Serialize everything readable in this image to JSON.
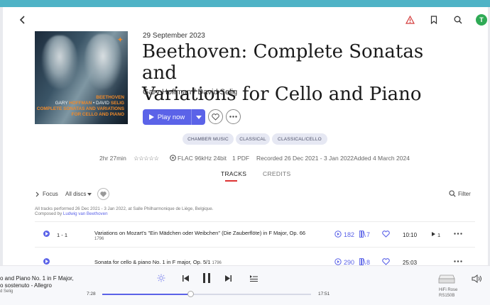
{
  "album": {
    "date": "29 September 2023",
    "title_line1": "Beethoven: Complete Sonatas and",
    "title_line2": "Variations for Cello and Piano",
    "artists": "Gary Hoffman / David Selig",
    "cover": {
      "label_brand": "BEETHOVEN",
      "line1_a": "GARY ",
      "line1_b": "HOFFMAN",
      "line1_c": " • DAVID ",
      "line1_d": "SELIG",
      "line2": "COMPLETE SONATAS AND VARIATIONS",
      "line3": "FOR CELLO AND PIANO"
    }
  },
  "actions": {
    "play_label": "Play now"
  },
  "tags": [
    "CHAMBER MUSIC",
    "CLASSICAL",
    "CLASSICAL/CELLO"
  ],
  "meta": {
    "duration": "2hr 27min",
    "rating": "☆☆☆☆☆",
    "format": "FLAC 96kHz 24bit",
    "pdf": "1 PDF",
    "recorded": "Recorded 26 Dec 2021 - 3 Jan 2022",
    "added": "Added 4 March 2024"
  },
  "tabs": {
    "tracks": "TRACKS",
    "credits": "CREDITS"
  },
  "toolbar": {
    "focus": "Focus",
    "discs": "All discs",
    "filter": "Filter"
  },
  "notes": {
    "line1": "All tracks performed 26 Dec 2021 - 3 Jan 2022, at Salle Philharmonique de Liège, Belgique.",
    "line2_prefix": "Composed by ",
    "composer": "Ludwig van Beethoven"
  },
  "tracks": [
    {
      "number": "1 - 1",
      "title": "Variations on Mozart's \"Ein Mädchen oder Weibchen\" (Die Zauberflöte) in F Major, Op. 66",
      "year": "1796",
      "plays": "182",
      "versions": "7",
      "duration": "10:10",
      "queue": "1"
    },
    {
      "number": "",
      "title": "Sonata for cello & piano No. 1 in F major, Op. 5/1",
      "year": "1796",
      "plays": "290",
      "versions": "8",
      "duration": "25:03"
    }
  ],
  "player": {
    "now_line1": "o and Piano No. 1 in F Major,",
    "now_line2": "o sostenuto - Allegro",
    "now_line3": "d Selig",
    "elapsed": "7:28",
    "total": "17:51",
    "progress": 0.425,
    "device_name": "HiFi Rose",
    "device_model": "RS150B"
  },
  "colors": {
    "accent": "#5b63e8",
    "top_strip": "#4fb3c6",
    "warning": "#d33a3a",
    "avatar": "#2faa55"
  }
}
